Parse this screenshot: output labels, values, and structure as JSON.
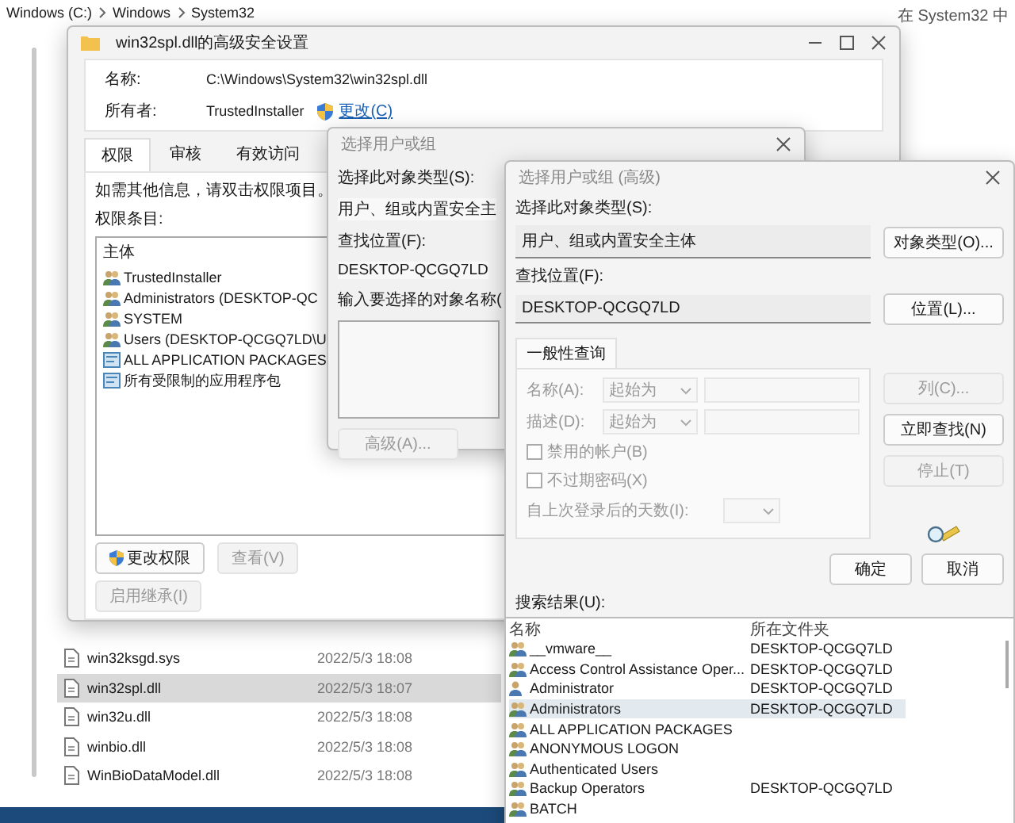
{
  "explorer": {
    "breadcrumb": [
      "Windows (C:)",
      "Windows",
      "System32"
    ],
    "search_placeholder": "在 System32 中",
    "files": [
      {
        "name": "win32ksgd.sys",
        "modified": "2022/5/3 18:08",
        "selected": false
      },
      {
        "name": "win32spl.dll",
        "modified": "2022/5/3 18:07",
        "selected": true
      },
      {
        "name": "win32u.dll",
        "modified": "2022/5/3 18:08",
        "selected": false
      },
      {
        "name": "winbio.dll",
        "modified": "2022/5/3 18:08",
        "selected": false
      },
      {
        "name": "WinBioDataModel.dll",
        "modified": "2022/5/3 18:08",
        "selected": false
      }
    ]
  },
  "security_window": {
    "title": "win32spl.dll的高级安全设置",
    "name_label": "名称:",
    "name_value": "C:\\Windows\\System32\\win32spl.dll",
    "owner_label": "所有者:",
    "owner_value": "TrustedInstaller",
    "change_link": "更改(C)",
    "tabs": [
      {
        "label": "权限",
        "selected": true
      },
      {
        "label": "审核",
        "selected": false
      },
      {
        "label": "有效访问",
        "selected": false
      }
    ],
    "hint": "如需其他信息，请双击权限项目。",
    "entries_label": "权限条目:",
    "column": "主体",
    "entries": [
      {
        "name": "TrustedInstaller",
        "kind": "group"
      },
      {
        "name": "Administrators (DESKTOP-QC",
        "kind": "group"
      },
      {
        "name": "SYSTEM",
        "kind": "group"
      },
      {
        "name": "Users (DESKTOP-QCGQ7LD\\U",
        "kind": "group"
      },
      {
        "name": "ALL APPLICATION PACKAGES",
        "kind": "package"
      },
      {
        "name": "所有受限制的应用程序包",
        "kind": "package"
      }
    ],
    "buttons": [
      {
        "label": "更改权限",
        "kind": "shield",
        "disabled": false
      },
      {
        "label": "查看(V)",
        "kind": "plain",
        "disabled": true
      }
    ],
    "inherit_button": {
      "label": "启用继承(I)",
      "disabled": true
    }
  },
  "select_window": {
    "title": "选择用户或组",
    "object_type_label": "选择此对象类型(S):",
    "object_type_value": "用户、组或内置安全主",
    "location_label": "查找位置(F):",
    "location_value": "DESKTOP-QCGQ7LD",
    "names_label": "输入要选择的对象名称(",
    "advanced_button": {
      "label": "高级(A)...",
      "disabled": true
    }
  },
  "advanced_window": {
    "title": "选择用户或组 (高级)",
    "object_type_label": "选择此对象类型(S):",
    "object_type_value": "用户、组或内置安全主体",
    "object_type_button": "对象类型(O)...",
    "location_label": "查找位置(F):",
    "location_value": "DESKTOP-QCGQ7LD",
    "location_button": "位置(L)...",
    "query_tab": "一般性查询",
    "query_disabled": true,
    "filters": [
      {
        "label": "名称(A):",
        "operator": "起始为"
      },
      {
        "label": "描述(D):",
        "operator": "起始为"
      }
    ],
    "checkboxes": [
      {
        "label": "禁用的帐户(B)",
        "checked": false
      },
      {
        "label": "不过期密码(X)",
        "checked": false
      }
    ],
    "days_label": "自上次登录后的天数(I):",
    "side_buttons": [
      {
        "label": "列(C)...",
        "disabled": true
      },
      {
        "label": "立即查找(N)",
        "disabled": false
      },
      {
        "label": "停止(T)",
        "disabled": true
      }
    ],
    "ok": "确定",
    "cancel": "取消",
    "results_label": "搜索结果(U):",
    "columns": [
      "名称",
      "所在文件夹"
    ],
    "results": [
      {
        "name": "__vmware__",
        "folder": "DESKTOP-QCGQ7LD",
        "kind": "group",
        "selected": false
      },
      {
        "name": "Access Control Assistance Oper...",
        "folder": "DESKTOP-QCGQ7LD",
        "kind": "group",
        "selected": false
      },
      {
        "name": "Administrator",
        "folder": "DESKTOP-QCGQ7LD",
        "kind": "user",
        "selected": false
      },
      {
        "name": "Administrators",
        "folder": "DESKTOP-QCGQ7LD",
        "kind": "group",
        "selected": true
      },
      {
        "name": "ALL APPLICATION PACKAGES",
        "kind": "group",
        "selected": false
      },
      {
        "name": "ANONYMOUS LOGON",
        "kind": "group",
        "selected": false
      },
      {
        "name": "Authenticated Users",
        "kind": "group",
        "selected": false
      },
      {
        "name": "Backup Operators",
        "folder": "DESKTOP-QCGQ7LD",
        "kind": "group",
        "selected": false
      },
      {
        "name": "BATCH",
        "kind": "group",
        "selected": false
      }
    ]
  }
}
